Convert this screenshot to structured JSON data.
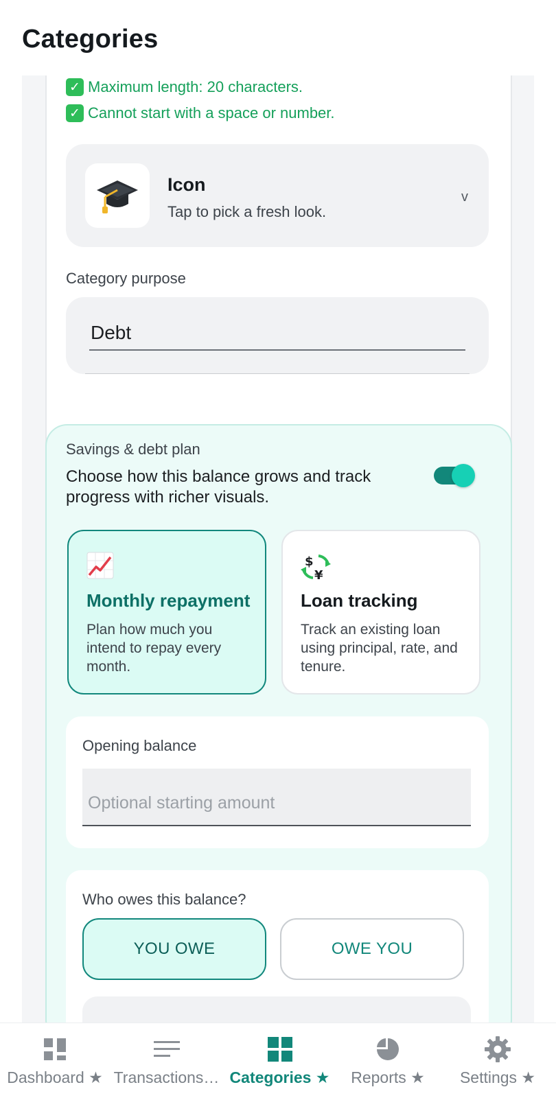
{
  "header": {
    "title": "Categories"
  },
  "rules": [
    {
      "text": "Maximum length: 20 characters."
    },
    {
      "text": "Cannot start with a space or number."
    }
  ],
  "icon_picker": {
    "title": "Icon",
    "subtitle": "Tap to pick a fresh look.",
    "chevron": "v",
    "icon": "graduation-cap-icon"
  },
  "purpose": {
    "label": "Category purpose",
    "value": "Debt"
  },
  "plan": {
    "label": "Savings & debt plan",
    "description": "Choose how this balance grows and track progress with richer visuals.",
    "enabled": true,
    "options": [
      {
        "title": "Monthly repayment",
        "description": "Plan how much you intend to repay every month.",
        "selected": true,
        "icon": "chart-increasing-icon"
      },
      {
        "title": "Loan tracking",
        "description": "Track an existing loan using principal, rate, and tenure.",
        "selected": false,
        "icon": "currency-exchange-icon"
      }
    ]
  },
  "opening_balance": {
    "label": "Opening balance",
    "placeholder": "Optional starting amount",
    "value": ""
  },
  "owes": {
    "label": "Who owes this balance?",
    "options": [
      {
        "label": "YOU OWE",
        "selected": true
      },
      {
        "label": "OWE YOU",
        "selected": false
      }
    ]
  },
  "bottom_nav": [
    {
      "label": "Dashboard ★",
      "icon": "dashboard-icon",
      "active": false
    },
    {
      "label": "Transactions…",
      "icon": "list-icon",
      "active": false
    },
    {
      "label": "Categories ★",
      "icon": "grid-icon",
      "active": true
    },
    {
      "label": "Reports ★",
      "icon": "pie-chart-icon",
      "active": false
    },
    {
      "label": "Settings ★",
      "icon": "gear-icon",
      "active": false
    }
  ],
  "colors": {
    "accent": "#12877a",
    "accent_light": "#dbfbf4",
    "success": "#15a05a",
    "plan_bg": "#ecfbf8"
  }
}
